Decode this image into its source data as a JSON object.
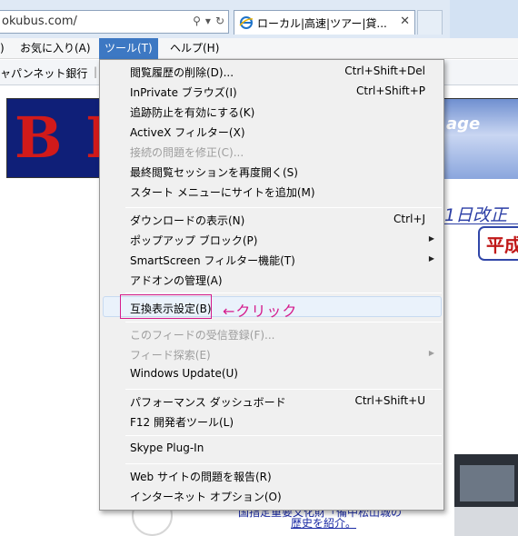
{
  "browser": {
    "address_url": "okubus.com/",
    "tab_title": "ローカル|高速|ツアー|貸...",
    "tab_close": "✕"
  },
  "menubar": {
    "items": [
      {
        "label": ")"
      },
      {
        "label": "お気に入り(A)"
      },
      {
        "label": "ツール(T)"
      },
      {
        "label": "ヘルプ(H)"
      }
    ]
  },
  "favorites": {
    "item": "ャパンネット銀行",
    "separator": "|"
  },
  "tools_menu": {
    "groups": [
      [
        {
          "label": "閲覧履歴の削除(D)...",
          "shortcut": "Ctrl+Shift+Del"
        },
        {
          "label": "InPrivate ブラウズ(I)",
          "shortcut": "Ctrl+Shift+P"
        },
        {
          "label": "追跡防止を有効にする(K)",
          "shortcut": ""
        },
        {
          "label": "ActiveX フィルター(X)",
          "shortcut": ""
        },
        {
          "label": "接続の問題を修正(C)...",
          "shortcut": "",
          "disabled": true
        },
        {
          "label": "最終閲覧セッションを再度開く(S)",
          "shortcut": ""
        },
        {
          "label": "スタート メニューにサイトを追加(M)",
          "shortcut": ""
        }
      ],
      [
        {
          "label": "ダウンロードの表示(N)",
          "shortcut": "Ctrl+J"
        },
        {
          "label": "ポップアップ ブロック(P)",
          "shortcut": "",
          "submenu": true
        },
        {
          "label": "SmartScreen フィルター機能(T)",
          "shortcut": "",
          "submenu": true
        },
        {
          "label": "アドオンの管理(A)",
          "shortcut": ""
        }
      ],
      [
        {
          "label": "互換表示設定(B)",
          "shortcut": "",
          "highlighted": true
        }
      ],
      [
        {
          "label": "このフィードの受信登録(F)...",
          "shortcut": "",
          "disabled": true
        },
        {
          "label": "フィード探索(E)",
          "shortcut": "",
          "disabled": true,
          "submenu": true
        },
        {
          "label": "Windows Update(U)",
          "shortcut": ""
        }
      ],
      [
        {
          "label": "パフォーマンス ダッシュボード",
          "shortcut": "Ctrl+Shift+U"
        },
        {
          "label": "F12 開発者ツール(L)",
          "shortcut": ""
        }
      ],
      [
        {
          "label": "Skype Plug-In",
          "shortcut": ""
        }
      ],
      [
        {
          "label": "Web サイトの問題を報告(R)",
          "shortcut": ""
        },
        {
          "label": "インターネット オプション(O)",
          "shortcut": ""
        }
      ]
    ]
  },
  "annotation": "←クリック",
  "page": {
    "banner_logo": "B I",
    "banner_text": "age",
    "notice": "1日改正",
    "year_box": "平成",
    "caption_line1": "国指定重要文化財「備中松山城の",
    "caption_line2": "歴史を紹介。"
  },
  "colors": {
    "menu_active": "#3d78c3",
    "highlight_box": "#d51b8c",
    "annotation": "#d51b8c",
    "banner_bg": "#0f1f78"
  }
}
